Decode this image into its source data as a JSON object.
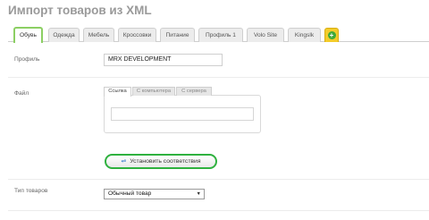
{
  "page": {
    "title": "Импорт товаров из XML"
  },
  "tabs": [
    {
      "label": "Обувь",
      "active": true
    },
    {
      "label": "Одежда"
    },
    {
      "label": "Мебель"
    },
    {
      "label": "Кроссовки"
    },
    {
      "label": "Питание"
    },
    {
      "label": "Профиль 1"
    },
    {
      "label": "Volo Site"
    },
    {
      "label": "Kingslk"
    }
  ],
  "add_tab_icon": "plus-icon",
  "form": {
    "profile_label": "Профиль",
    "profile_value": "MRX DEVELOPMENT",
    "file_label": "Файл",
    "file_tabs": [
      {
        "label": "Ссылка",
        "active": true
      },
      {
        "label": "С компьютера"
      },
      {
        "label": "С сервера"
      }
    ],
    "file_url_value": "",
    "match_button_label": "Установить соответствия",
    "match_button_icon": "arrows-icon",
    "product_type_label": "Тип товаров",
    "product_type_value": "Обычный товар"
  },
  "colors": {
    "active_tab_border": "#8ccf63",
    "add_tab_bg": "#f3cc2a",
    "button_border": "#2fb13f"
  }
}
